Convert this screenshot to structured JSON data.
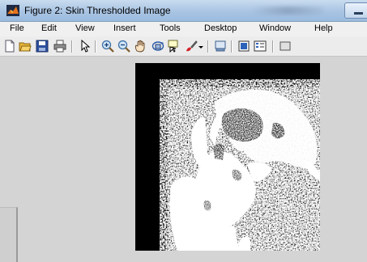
{
  "window": {
    "title": "Figure 2: Skin Thresholded Image"
  },
  "menu": {
    "items": [
      "File",
      "Edit",
      "View",
      "Insert",
      "Tools",
      "Desktop",
      "Window",
      "Help"
    ]
  },
  "toolbar": {
    "buttons": [
      "new-figure",
      "open-file",
      "save-figure",
      "print-figure",
      "edit-plot",
      "zoom-in",
      "zoom-out",
      "pan",
      "rotate-3d",
      "data-cursor",
      "brush",
      "link-plot",
      "insert-colorbar",
      "insert-legend",
      "hide-plot-tools"
    ]
  },
  "colors": {
    "title_gradient_top": "#c9dcef",
    "figure_background": "#d4d4d4",
    "image_background": "#000000",
    "image_foreground": "#ffffff"
  }
}
